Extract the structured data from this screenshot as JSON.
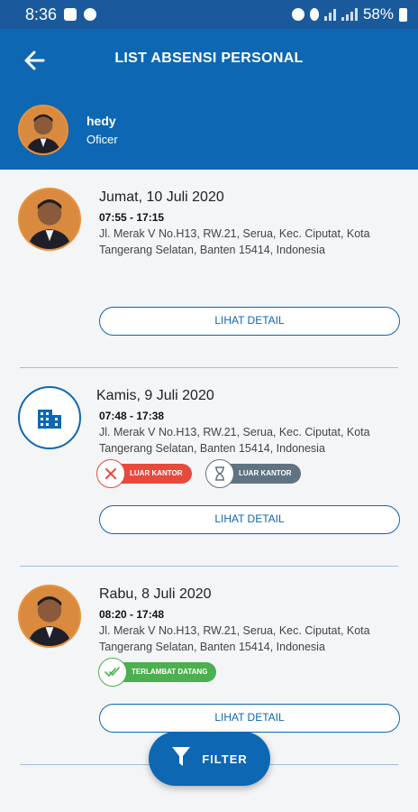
{
  "status_bar": {
    "time": "8:36",
    "battery": "58%"
  },
  "app_bar": {
    "title": "LIST ABSENSI PERSONAL",
    "back_icon": "arrow-left-icon"
  },
  "user": {
    "name": "hedy",
    "role": "Oficer"
  },
  "records": [
    {
      "date": "Jumat, 10 Juli 2020",
      "time": "07:55 - 17:15",
      "address": "Jl. Merak V No.H13, RW.21, Serua, Kec. Ciputat, Kota Tangerang Selatan, Banten 15414, Indonesia",
      "detail_label": "LIHAT DETAIL"
    },
    {
      "date": "Kamis, 9 Juli 2020",
      "time": "07:48 - 17:38",
      "address": "Jl. Merak V No.H13, RW.21, Serua, Kec. Ciputat, Kota Tangerang Selatan, Banten 15414, Indonesia",
      "badges": [
        "LUAR KANTOR",
        "LUAR KANTOR"
      ],
      "detail_label": "LIHAT DETAIL"
    },
    {
      "date": "Rabu, 8 Juli 2020",
      "time": "08:20 - 17:48",
      "address": "Jl. Merak V No.H13, RW.21, Serua, Kec. Ciputat, Kota Tangerang Selatan, Banten 15414, Indonesia",
      "badges": [
        "TERLAMBAT DATANG"
      ],
      "detail_label": "LIHAT DETAIL"
    }
  ],
  "fab": {
    "label": "FILTER",
    "icon": "filter-icon"
  },
  "colors": {
    "primary": "#0d67b3",
    "red": "#e64a3c",
    "gray": "#5f7480",
    "green": "#4caf50"
  }
}
